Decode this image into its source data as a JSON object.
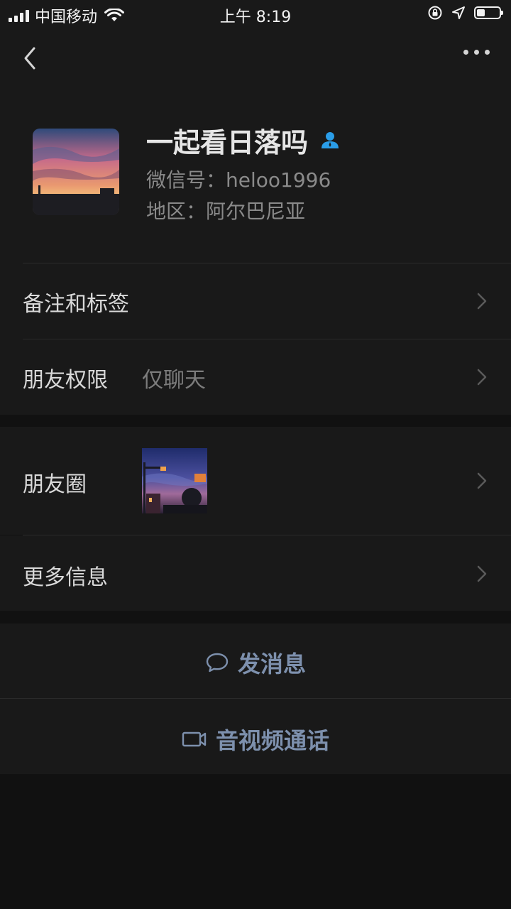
{
  "status_bar": {
    "carrier": "中国移动",
    "time": "上午 8:19",
    "battery_level": 0.35
  },
  "nav": {
    "back_icon": "chevron-left-icon",
    "more_icon": "more-dots-icon"
  },
  "profile": {
    "name": "一起看日落吗",
    "wechat_id": "微信号：heloo1996",
    "region": "地区：阿尔巴尼亚",
    "badge_icon": "person-badge-icon",
    "badge_color": "#2a9de8"
  },
  "rows": {
    "remark_tags": {
      "label": "备注和标签"
    },
    "friend_permission": {
      "label": "朋友权限",
      "value": "仅聊天"
    },
    "moments": {
      "label": "朋友圈"
    },
    "more_info": {
      "label": "更多信息"
    }
  },
  "actions": {
    "send_message": {
      "label": "发消息",
      "icon": "chat-bubble-icon"
    },
    "video_call": {
      "label": "音视频通话",
      "icon": "video-camera-icon"
    },
    "accent_color": "#7d90ad"
  }
}
